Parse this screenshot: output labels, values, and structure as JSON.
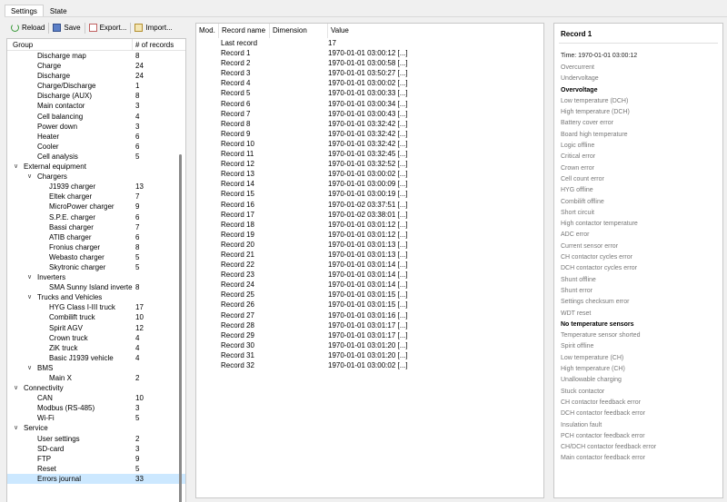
{
  "tabs": [
    "Settings",
    "State"
  ],
  "toolbar": {
    "reload": "Reload",
    "save": "Save",
    "export": "Export...",
    "import": "Import..."
  },
  "tree": {
    "col_group": "Group",
    "col_count": "# of records",
    "rows": [
      {
        "name": "Discharge map",
        "count": "8",
        "level": 2
      },
      {
        "name": "Charge",
        "count": "24",
        "level": 2
      },
      {
        "name": "Discharge",
        "count": "24",
        "level": 2
      },
      {
        "name": "Charge/Discharge",
        "count": "1",
        "level": 2
      },
      {
        "name": "Discharge (AUX)",
        "count": "8",
        "level": 2
      },
      {
        "name": "Main contactor",
        "count": "3",
        "level": 2
      },
      {
        "name": "Cell balancing",
        "count": "4",
        "level": 2
      },
      {
        "name": "Power down",
        "count": "3",
        "level": 2
      },
      {
        "name": "Heater",
        "count": "6",
        "level": 2
      },
      {
        "name": "Cooler",
        "count": "6",
        "level": 2
      },
      {
        "name": "Cell analysis",
        "count": "5",
        "level": 2
      },
      {
        "name": "External equipment",
        "count": "",
        "level": 1,
        "expanded": true
      },
      {
        "name": "Chargers",
        "count": "",
        "level": 2,
        "expanded": true
      },
      {
        "name": "J1939 charger",
        "count": "13",
        "level": 3
      },
      {
        "name": "Eltek charger",
        "count": "7",
        "level": 3
      },
      {
        "name": "MicroPower charger",
        "count": "9",
        "level": 3
      },
      {
        "name": "S.P.E. charger",
        "count": "6",
        "level": 3
      },
      {
        "name": "Bassi charger",
        "count": "7",
        "level": 3
      },
      {
        "name": "ATIB charger",
        "count": "6",
        "level": 3
      },
      {
        "name": "Fronius charger",
        "count": "8",
        "level": 3
      },
      {
        "name": "Webasto charger",
        "count": "5",
        "level": 3
      },
      {
        "name": "Skytronic charger",
        "count": "5",
        "level": 3
      },
      {
        "name": "Inverters",
        "count": "",
        "level": 2,
        "expanded": true
      },
      {
        "name": "SMA Sunny Island inverter",
        "count": "8",
        "level": 3
      },
      {
        "name": "Trucks and Vehicles",
        "count": "",
        "level": 2,
        "expanded": true
      },
      {
        "name": "HYG Class I-III truck",
        "count": "17",
        "level": 3
      },
      {
        "name": "Combilift truck",
        "count": "10",
        "level": 3
      },
      {
        "name": "Spirit AGV",
        "count": "12",
        "level": 3
      },
      {
        "name": "Crown truck",
        "count": "4",
        "level": 3
      },
      {
        "name": "ZiK truck",
        "count": "4",
        "level": 3
      },
      {
        "name": "Basic J1939 vehicle",
        "count": "4",
        "level": 3
      },
      {
        "name": "BMS",
        "count": "",
        "level": 2,
        "expanded": true
      },
      {
        "name": "Main X",
        "count": "2",
        "level": 3
      },
      {
        "name": "Connectivity",
        "count": "",
        "level": 1,
        "expanded": true
      },
      {
        "name": "CAN",
        "count": "10",
        "level": 2
      },
      {
        "name": "Modbus (RS-485)",
        "count": "3",
        "level": 2
      },
      {
        "name": "Wi-Fi",
        "count": "5",
        "level": 2
      },
      {
        "name": "Service",
        "count": "",
        "level": 1,
        "expanded": true
      },
      {
        "name": "User settings",
        "count": "2",
        "level": 2
      },
      {
        "name": "SD-card",
        "count": "3",
        "level": 2
      },
      {
        "name": "FTP",
        "count": "9",
        "level": 2
      },
      {
        "name": "Reset",
        "count": "5",
        "level": 2
      },
      {
        "name": "Errors journal",
        "count": "33",
        "level": 2,
        "selected": true
      }
    ]
  },
  "records": {
    "col_mod": "Mod.",
    "col_name": "Record name",
    "col_dim": "Dimension",
    "col_value": "Value",
    "rows": [
      {
        "name": "Last record",
        "value": "17"
      },
      {
        "name": "Record 1",
        "value": "1970-01-01 03:00:12 [...]"
      },
      {
        "name": "Record 2",
        "value": "1970-01-01 03:00:58 [...]"
      },
      {
        "name": "Record 3",
        "value": "1970-01-01 03:50:27 [...]"
      },
      {
        "name": "Record 4",
        "value": "1970-01-01 03:00:02 [...]"
      },
      {
        "name": "Record 5",
        "value": "1970-01-01 03:00:33 [...]"
      },
      {
        "name": "Record 6",
        "value": "1970-01-01 03:00:34 [...]"
      },
      {
        "name": "Record 7",
        "value": "1970-01-01 03:00:43 [...]"
      },
      {
        "name": "Record 8",
        "value": "1970-01-01 03:32:42 [...]"
      },
      {
        "name": "Record 9",
        "value": "1970-01-01 03:32:42 [...]"
      },
      {
        "name": "Record 10",
        "value": "1970-01-01 03:32:42 [...]"
      },
      {
        "name": "Record 11",
        "value": "1970-01-01 03:32:45 [...]"
      },
      {
        "name": "Record 12",
        "value": "1970-01-01 03:32:52 [...]"
      },
      {
        "name": "Record 13",
        "value": "1970-01-01 03:00:02 [...]"
      },
      {
        "name": "Record 14",
        "value": "1970-01-01 03:00:09 [...]"
      },
      {
        "name": "Record 15",
        "value": "1970-01-01 03:00:19 [...]"
      },
      {
        "name": "Record 16",
        "value": "1970-01-02 03:37:51 [...]"
      },
      {
        "name": "Record 17",
        "value": "1970-01-02 03:38:01 [...]"
      },
      {
        "name": "Record 18",
        "value": "1970-01-01 03:01:12 [...]"
      },
      {
        "name": "Record 19",
        "value": "1970-01-01 03:01:12 [...]"
      },
      {
        "name": "Record 20",
        "value": "1970-01-01 03:01:13 [...]"
      },
      {
        "name": "Record 21",
        "value": "1970-01-01 03:01:13 [...]"
      },
      {
        "name": "Record 22",
        "value": "1970-01-01 03:01:14 [...]"
      },
      {
        "name": "Record 23",
        "value": "1970-01-01 03:01:14 [...]"
      },
      {
        "name": "Record 24",
        "value": "1970-01-01 03:01:14 [...]"
      },
      {
        "name": "Record 25",
        "value": "1970-01-01 03:01:15 [...]"
      },
      {
        "name": "Record 26",
        "value": "1970-01-01 03:01:15 [...]"
      },
      {
        "name": "Record 27",
        "value": "1970-01-01 03:01:16 [...]"
      },
      {
        "name": "Record 28",
        "value": "1970-01-01 03:01:17 [...]"
      },
      {
        "name": "Record 29",
        "value": "1970-01-01 03:01:17 [...]"
      },
      {
        "name": "Record 30",
        "value": "1970-01-01 03:01:20 [...]"
      },
      {
        "name": "Record 31",
        "value": "1970-01-01 03:01:20 [...]"
      },
      {
        "name": "Record 32",
        "value": "1970-01-01 03:00:02 [...]"
      }
    ]
  },
  "detail": {
    "title": "Record 1",
    "time": "Time:  1970-01-01 03:00:12",
    "flags": [
      {
        "label": "Overcurrent",
        "active": false
      },
      {
        "label": "Undervoltage",
        "active": false
      },
      {
        "label": "Overvoltage",
        "active": true
      },
      {
        "label": "Low temperature (DCH)",
        "active": false
      },
      {
        "label": "High temperature (DCH)",
        "active": false
      },
      {
        "label": "Battery cover error",
        "active": false
      },
      {
        "label": "Board high temperature",
        "active": false
      },
      {
        "label": "Logic offline",
        "active": false
      },
      {
        "label": "Critical error",
        "active": false
      },
      {
        "label": "Crown error",
        "active": false
      },
      {
        "label": "Cell count error",
        "active": false
      },
      {
        "label": "HYG offline",
        "active": false
      },
      {
        "label": "Combilift offline",
        "active": false
      },
      {
        "label": "Short circuit",
        "active": false
      },
      {
        "label": "High contactor temperature",
        "active": false
      },
      {
        "label": "ADC error",
        "active": false
      },
      {
        "label": "Current sensor error",
        "active": false
      },
      {
        "label": "CH contactor cycles error",
        "active": false
      },
      {
        "label": "DCH contactor cycles error",
        "active": false
      },
      {
        "label": "Shunt offline",
        "active": false
      },
      {
        "label": "Shunt error",
        "active": false
      },
      {
        "label": "Settings checksum error",
        "active": false
      },
      {
        "label": "WDT reset",
        "active": false
      },
      {
        "label": "No temperature sensors",
        "active": true
      },
      {
        "label": "Temperature sensor shorted",
        "active": false
      },
      {
        "label": "Spirit offline",
        "active": false
      },
      {
        "label": "Low temperature (CH)",
        "active": false
      },
      {
        "label": "High temperature (CH)",
        "active": false
      },
      {
        "label": "Unallowable charging",
        "active": false
      },
      {
        "label": "Stuck contactor",
        "active": false
      },
      {
        "label": "CH contactor feedback error",
        "active": false
      },
      {
        "label": "DCH contactor feedback error",
        "active": false
      },
      {
        "label": "Insulation fault",
        "active": false
      },
      {
        "label": "PCH contactor feedback error",
        "active": false
      },
      {
        "label": "CH/DCH contactor feedback error",
        "active": false
      },
      {
        "label": "Main contactor feedback error",
        "active": false
      }
    ]
  }
}
